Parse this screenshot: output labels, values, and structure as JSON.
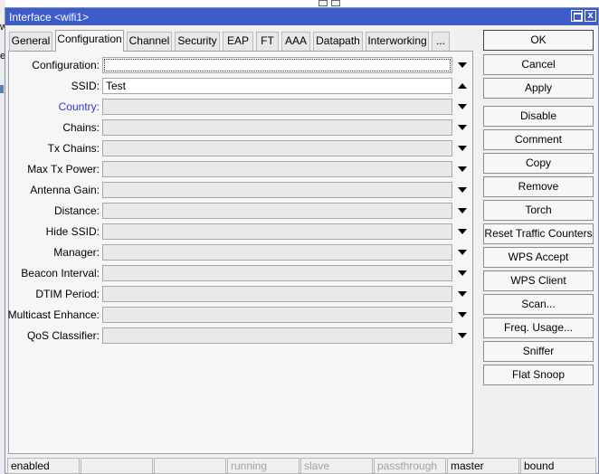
{
  "window": {
    "title": "Interface <wifi1>",
    "close_glyph": "x"
  },
  "background": {
    "left_fragments": [
      "w",
      "e"
    ]
  },
  "tabs": [
    {
      "label": "General",
      "active": false
    },
    {
      "label": "Configuration",
      "active": true
    },
    {
      "label": "Channel",
      "active": false
    },
    {
      "label": "Security",
      "active": false
    },
    {
      "label": "EAP",
      "active": false
    },
    {
      "label": "FT",
      "active": false
    },
    {
      "label": "AAA",
      "active": false
    },
    {
      "label": "Datapath",
      "active": false
    },
    {
      "label": "Interworking",
      "active": false
    },
    {
      "label": "...",
      "active": false
    }
  ],
  "fields": [
    {
      "label": "Configuration:",
      "value": "",
      "arrow": "down"
    },
    {
      "label": "SSID:",
      "value": "Test",
      "arrow": "up"
    },
    {
      "label": "Country:",
      "value": "",
      "arrow": "down",
      "link": true
    },
    {
      "label": "Chains:",
      "value": "",
      "arrow": "down"
    },
    {
      "label": "Tx Chains:",
      "value": "",
      "arrow": "down"
    },
    {
      "label": "Max Tx Power:",
      "value": "",
      "arrow": "down"
    },
    {
      "label": "Antenna Gain:",
      "value": "",
      "arrow": "down"
    },
    {
      "label": "Distance:",
      "value": "",
      "arrow": "down"
    },
    {
      "label": "Hide SSID:",
      "value": "",
      "arrow": "down"
    },
    {
      "label": "Manager:",
      "value": "",
      "arrow": "down"
    },
    {
      "label": "Beacon Interval:",
      "value": "",
      "arrow": "down"
    },
    {
      "label": "DTIM Period:",
      "value": "",
      "arrow": "down"
    },
    {
      "label": "Multicast Enhance:",
      "value": "",
      "arrow": "down"
    },
    {
      "label": "QoS Classifier:",
      "value": "",
      "arrow": "down"
    }
  ],
  "buttons": [
    "OK",
    "Cancel",
    "Apply",
    "Disable",
    "Comment",
    "Copy",
    "Remove",
    "Torch",
    "Reset Traffic Counters",
    "WPS Accept",
    "WPS Client",
    "Scan...",
    "Freq. Usage...",
    "Sniffer",
    "Flat Snoop"
  ],
  "status": [
    {
      "text": "enabled",
      "dim": false
    },
    {
      "text": "",
      "dim": false
    },
    {
      "text": "",
      "dim": false
    },
    {
      "text": "running",
      "dim": true
    },
    {
      "text": "slave",
      "dim": true
    },
    {
      "text": "passthrough",
      "dim": true
    },
    {
      "text": "master",
      "dim": false
    },
    {
      "text": "bound",
      "dim": false
    }
  ]
}
